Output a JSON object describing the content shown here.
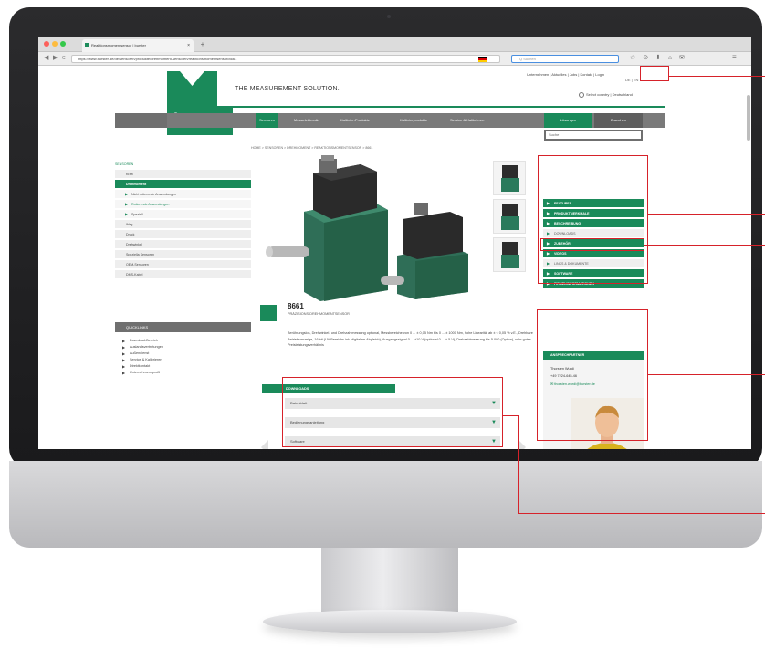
{
  "browser": {
    "tab_title": "Reaktionsmomentsensor | burster",
    "tab_close": "×",
    "new_tab": "+",
    "url": "https://www.burster.de/de/sensoren/produkte/drehmoment-sensoren/reaktionsmomentsensor/8661",
    "search_placeholder": "Q Suchen",
    "toolbar_icons": "☆ ⊙ ⬇ ⌂ ✉",
    "menu_icon": "≡",
    "back": "◀",
    "forward": "▶",
    "reload": "C"
  },
  "header": {
    "logo_text": "burster",
    "tagline": "THE MEASUREMENT SOLUTION.",
    "top_links": "Unternehmen | Aktuelles | Jobs | Kontakt | Login",
    "language": "DE | EN",
    "country": "Select country | Deutschland"
  },
  "main_nav": {
    "items": [
      "Sensoren",
      "Messelektronik",
      "Kalibrier-Produkte",
      "Kalibrierprodukte",
      "Service & Kalibrieren"
    ],
    "btn_loesungen": "Lösungen",
    "btn_branchen": "Branchen",
    "search_placeholder": "Suche"
  },
  "breadcrumb": "HOME > SENSOREN > DREHMOMENT > REAKTIONSMOMENTSENSOR > 8661",
  "sidebar": {
    "title": "SENSOREN",
    "items": [
      {
        "label": "Kraft",
        "type": "normal"
      },
      {
        "label": "Drehmoment",
        "type": "active"
      },
      {
        "label": "Nicht rotierende Anwendungen",
        "type": "sub"
      },
      {
        "label": "Rotierende Anwendungen",
        "type": "sub-selected"
      },
      {
        "label": "Speziell",
        "type": "normal"
      },
      {
        "label": "Weg",
        "type": "normal"
      },
      {
        "label": "Druck",
        "type": "normal"
      },
      {
        "label": "Drehwinkel",
        "type": "normal"
      },
      {
        "label": "Speziella Sensoren",
        "type": "normal"
      },
      {
        "label": "OEM-Sensoren",
        "type": "normal"
      },
      {
        "label": "DMS-Kabel",
        "type": "normal"
      }
    ],
    "quicklinks_title": "QUICKLINKS",
    "quicklinks": [
      "Download-Bereich",
      "Auslandsvertretungen",
      "Außendienst",
      "Service & Kalibrieren",
      "Direktkontakt",
      "Unternehmensprofil"
    ]
  },
  "product": {
    "number": "8661",
    "subtitle": "PRÄZISIONS-DREHMOMENTSENSOR",
    "description": "Berührungslos, Drehwinkel- und Drehzahlmessung optional, Messbereiche von 0 ... ± 0,05 Nm bis 0 ... ± 1000 Nm, hohe Linearität ab ± < 0,05 % v.E., Drehbare Betriebsanzeige, 16 bit (UV-Bereichs ink. digitalem Abgleich), Ausgangssignal 0 ... ±10 V (optional 0 ... ± 5 V), Drehzahlmessung bis 5.000 (Option), sehr gutes Preisleistungsverhältnis",
    "downloads_title": "DOWNLOADS",
    "downloads": [
      "Datenblatt",
      "Bedienungsanleitung",
      "Software"
    ],
    "chevron": "▼"
  },
  "right_panel": {
    "items": [
      {
        "label": "FEATURES",
        "type": "green"
      },
      {
        "label": "PRODUKTMERKMALE",
        "type": "green"
      },
      {
        "label": "BESCHREIBUNG",
        "type": "green"
      },
      {
        "label": "DOWNLOADS",
        "type": "light"
      },
      {
        "label": "ZUBEHÖR",
        "type": "green"
      },
      {
        "label": "VIDEOS",
        "type": "green"
      },
      {
        "label": "LINKS & DOKUMENTE",
        "type": "light"
      },
      {
        "label": "SOFTWARE",
        "type": "green"
      },
      {
        "label": "FIRMENINFORMATIONEN",
        "type": "green"
      }
    ],
    "contact_title": "ANSPRECHPARTNER",
    "contact_name": "Thorsten Wurdi",
    "contact_phone": "+49 7224-645-46",
    "contact_email": "✉ thorsten.wurdi@burster.de"
  },
  "colors": {
    "brand_green": "#1a8a5a",
    "nav_gray": "#7a7a7a",
    "annotation_red": "#d6222a"
  }
}
